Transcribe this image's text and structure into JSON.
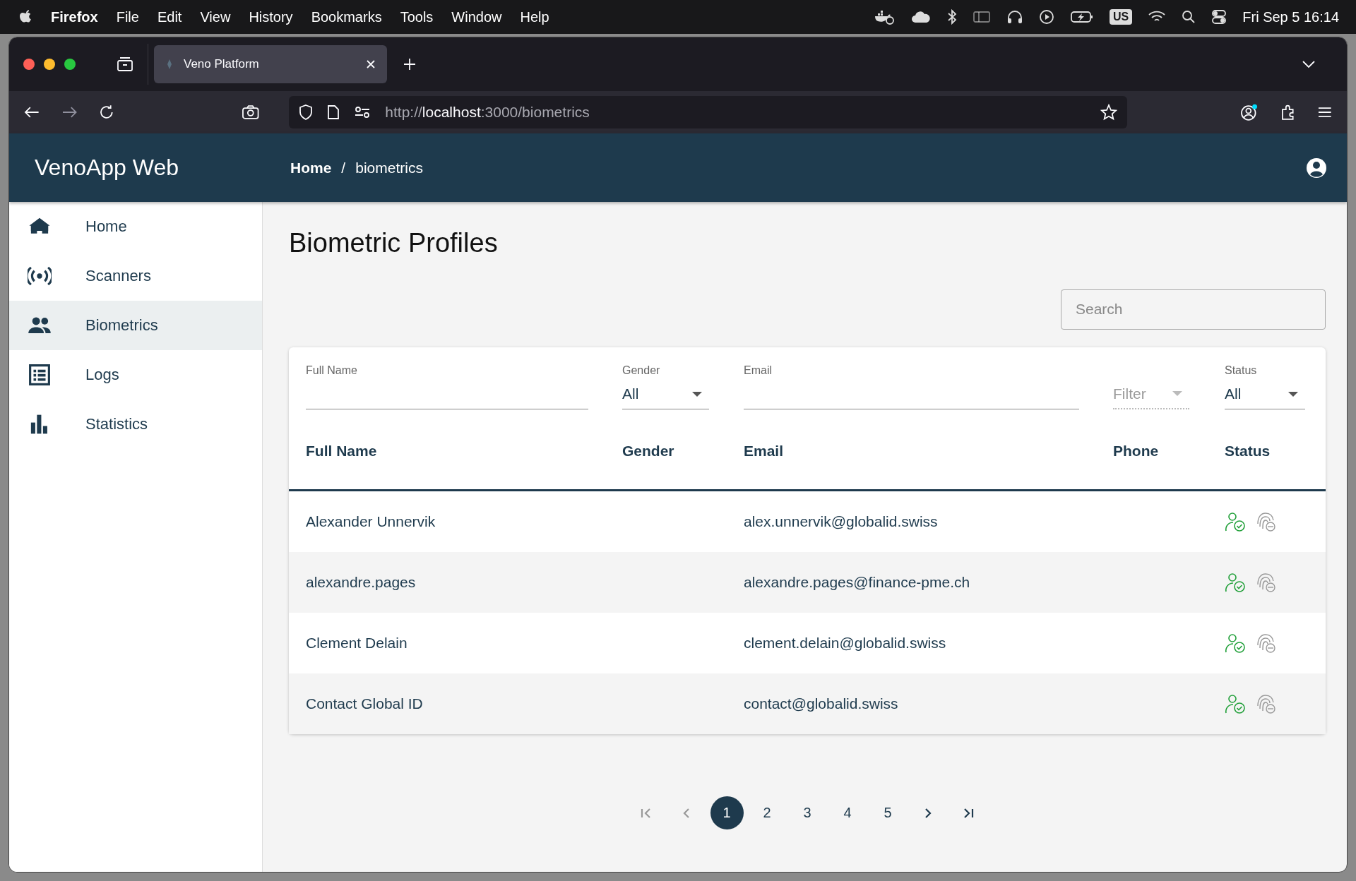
{
  "menubar": {
    "app": "Firefox",
    "menus": [
      "File",
      "Edit",
      "View",
      "History",
      "Bookmarks",
      "Tools",
      "Window",
      "Help"
    ],
    "input_source": "US",
    "clock": "Fri Sep 5  16:14"
  },
  "browser": {
    "tabs": [
      {
        "title": "Veno Platform",
        "selected": true
      }
    ],
    "url": "http://**localhost**:3000/biometrics"
  },
  "header": {
    "brand": "VenoApp Web",
    "breadcrumb": [
      {
        "label": "Home",
        "current": false
      },
      {
        "label": "biometrics",
        "current": true
      }
    ],
    "separator": "/"
  },
  "sidebar": {
    "items": [
      {
        "kind": "home",
        "label": "Home",
        "selected": false
      },
      {
        "kind": "scanner",
        "label": "Scanners",
        "selected": false
      },
      {
        "kind": "people",
        "label": "Biometrics",
        "selected": true
      },
      {
        "kind": "list",
        "label": "Logs",
        "selected": false
      },
      {
        "kind": "chart",
        "label": "Statistics",
        "selected": false
      }
    ]
  },
  "page": {
    "title": "Biometric Profiles",
    "search": {
      "placeholder": "Search"
    }
  },
  "table": {
    "filters": [
      {
        "kind": "text",
        "label": "Full Name"
      },
      {
        "kind": "select",
        "label": "Gender",
        "value": "All",
        "disabled": false
      },
      {
        "kind": "text",
        "label": "Email"
      },
      {
        "kind": "select",
        "placeholder": "Filter",
        "disabled": true
      },
      {
        "kind": "select",
        "label": "Status",
        "value": "All",
        "disabled": false
      }
    ],
    "columns": [
      "Full Name",
      "Gender",
      "Email",
      "Phone",
      "Status"
    ],
    "rows": [
      {
        "full_name": "Alexander Unnervik",
        "email": "alex.unnervik@globalid.swiss",
        "profile_verified": true,
        "fingerprint_enrolled": false
      },
      {
        "full_name": "alexandre.pages",
        "email": "alexandre.pages@finance-pme.ch",
        "profile_verified": true,
        "fingerprint_enrolled": false
      },
      {
        "full_name": "Clement Delain",
        "email": "clement.delain@globalid.swiss",
        "profile_verified": true,
        "fingerprint_enrolled": false
      },
      {
        "full_name": "Contact Global ID",
        "email": "contact@globalid.swiss",
        "profile_verified": true,
        "fingerprint_enrolled": false
      }
    ]
  },
  "pagination": {
    "first_disabled": true,
    "prev_disabled": true,
    "next_disabled": false,
    "last_disabled": false,
    "pages": [
      {
        "label": "1",
        "selected": true
      },
      {
        "label": "2",
        "selected": false
      },
      {
        "label": "3",
        "selected": false
      },
      {
        "label": "4",
        "selected": false
      },
      {
        "label": "5",
        "selected": false
      }
    ]
  }
}
